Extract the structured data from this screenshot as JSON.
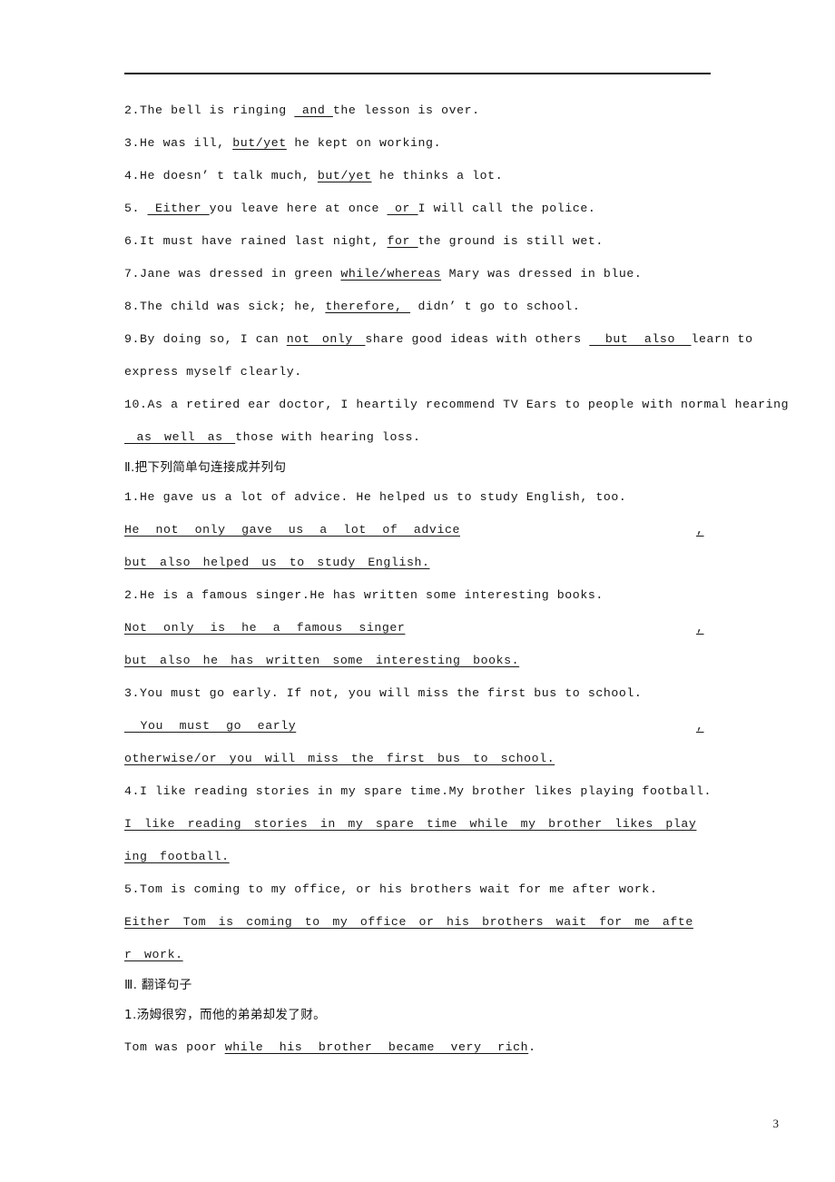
{
  "page": {
    "number": "3",
    "divider": "horizontal-rule"
  },
  "section_one_items": [
    {
      "num": "2.",
      "pre": "The bell is ringing ",
      "blank": " and ",
      "post": "the lesson is over."
    },
    {
      "num": "3.",
      "pre": "He was ill, ",
      "blank": "but/yet",
      "post": " he kept on working."
    },
    {
      "num": "4.",
      "pre": "He doesn’ t talk much, ",
      "blank": "but/yet",
      "post": " he thinks a lot."
    },
    {
      "num": "5.",
      "pre": " ",
      "blank": " Either ",
      "post": "you leave here at once ",
      "blank2": " or ",
      "post2": "I will call the police."
    },
    {
      "num": "6.",
      "pre": "It must have rained last night, ",
      "blank": "for ",
      "post": "the ground is still wet."
    },
    {
      "num": "7.",
      "pre": "Jane was dressed in green ",
      "blank": "while/whereas",
      "post": " Mary was dressed in blue."
    },
    {
      "num": "8.",
      "pre": "The child was sick; he, ",
      "blank": "therefore, ",
      "post": " didn’ t go to school."
    },
    {
      "num": "9.",
      "pre": "By doing so, I can ",
      "blank": "not only ",
      "post": "share good ideas with others ",
      "blank2": " but also ",
      "post2": "learn to",
      "wrap": "express myself clearly."
    },
    {
      "num": "10.",
      "pre": "As a retired ear doctor, I heartily recommend TV Ears to people with normal hearing",
      "blank": " as well as ",
      "post": "those with hearing loss.",
      "wrap_is_blank": true
    }
  ],
  "section_two": {
    "heading": "Ⅱ.把下列简单句连接成并列句",
    "items": [
      {
        "num": "1.",
        "prompt": "He gave us a lot of advice. He helped us to study English, too.",
        "answer_line_1": "He not only gave us a lot of advice",
        "answer_comma": ",",
        "answer_line_2": "but also helped us to study English."
      },
      {
        "num": "2.",
        "prompt": "He is a famous singer.He has written some interesting books.",
        "answer_line_1": "Not only is he a famous singer",
        "answer_comma": ",",
        "answer_line_2": "but also he has written some interesting books."
      },
      {
        "num": "3.",
        "prompt": "You must go early. If not, you will miss the first bus to school.",
        "answer_line_1": " You must go early",
        "answer_comma": ",",
        "answer_line_2": "otherwise/or you will miss the first bus to school."
      },
      {
        "num": "4.",
        "prompt": "I like reading stories in my spare time.My brother likes playing football.",
        "answer_line_1": "I like reading stories in my spare time while my brother likes play",
        "answer_comma": "",
        "answer_line_2": "ing football."
      },
      {
        "num": "5.",
        "prompt": "Tom is coming to my office, or his brothers wait for me after work.",
        "answer_line_1": "Either Tom is coming to my office or his brothers wait for me afte",
        "answer_comma": "",
        "answer_line_2": "r work."
      }
    ]
  },
  "section_three": {
    "heading": "Ⅲ. 翻译句子",
    "items": [
      {
        "num": "1.",
        "prompt": "汤姆很穷，而他的弟弟却发了财。",
        "answer_pre": "Tom was poor ",
        "answer_blank": "while his brother became very rich",
        "answer_post": "."
      }
    ]
  }
}
